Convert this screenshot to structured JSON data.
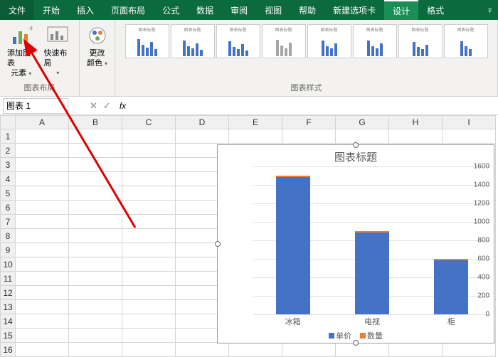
{
  "tabs": {
    "file": "文件",
    "home": "开始",
    "insert": "插入",
    "pagelayout": "页面布局",
    "formulas": "公式",
    "data": "数据",
    "review": "审阅",
    "view": "视图",
    "help": "帮助",
    "newtab": "新建选项卡",
    "design": "设计",
    "format": "格式"
  },
  "ribbon": {
    "add_element_l1": "添加图表",
    "add_element_l2": "元素",
    "quick_layout": "快速布局",
    "layout_group": "图表布局",
    "change_colors_l1": "更改",
    "change_colors_l2": "颜色",
    "styles_group": "图表样式"
  },
  "namebox": "图表 1",
  "columns": [
    "A",
    "B",
    "C",
    "D",
    "E",
    "F",
    "G",
    "H",
    "I"
  ],
  "rows": [
    "1",
    "2",
    "3",
    "4",
    "5",
    "6",
    "7",
    "8",
    "9",
    "10",
    "11",
    "12",
    "13",
    "14",
    "15",
    "16"
  ],
  "chart_data": {
    "type": "bar",
    "title": "图表标题",
    "categories": [
      "冰箱",
      "电视",
      "柜"
    ],
    "series": [
      {
        "name": "单价",
        "values": [
          1500,
          900,
          600
        ]
      },
      {
        "name": "数量",
        "values": [
          20,
          15,
          10
        ]
      }
    ],
    "ylim": [
      0,
      1600
    ],
    "ystep": 200,
    "xlabel": "",
    "ylabel": ""
  },
  "legend": {
    "s1": "单价",
    "s2": "数量"
  }
}
